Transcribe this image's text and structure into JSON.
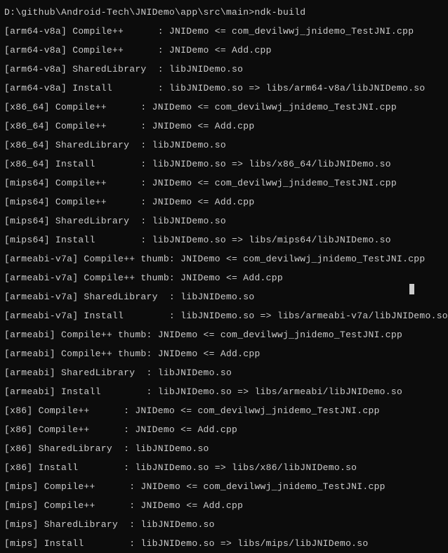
{
  "prompt": {
    "path": "D:\\github\\Android-Tech\\JNIDemo\\app\\src\\main>",
    "command": "ndk-build"
  },
  "lines": [
    "[arm64-v8a] Compile++      : JNIDemo <= com_devilwwj_jnidemo_TestJNI.cpp",
    "[arm64-v8a] Compile++      : JNIDemo <= Add.cpp",
    "[arm64-v8a] SharedLibrary  : libJNIDemo.so",
    "[arm64-v8a] Install        : libJNIDemo.so => libs/arm64-v8a/libJNIDemo.so",
    "[x86_64] Compile++      : JNIDemo <= com_devilwwj_jnidemo_TestJNI.cpp",
    "[x86_64] Compile++      : JNIDemo <= Add.cpp",
    "[x86_64] SharedLibrary  : libJNIDemo.so",
    "[x86_64] Install        : libJNIDemo.so => libs/x86_64/libJNIDemo.so",
    "[mips64] Compile++      : JNIDemo <= com_devilwwj_jnidemo_TestJNI.cpp",
    "[mips64] Compile++      : JNIDemo <= Add.cpp",
    "[mips64] SharedLibrary  : libJNIDemo.so",
    "[mips64] Install        : libJNIDemo.so => libs/mips64/libJNIDemo.so",
    "[armeabi-v7a] Compile++ thumb: JNIDemo <= com_devilwwj_jnidemo_TestJNI.cpp",
    "[armeabi-v7a] Compile++ thumb: JNIDemo <= Add.cpp",
    "[armeabi-v7a] SharedLibrary  : libJNIDemo.so",
    "[armeabi-v7a] Install        : libJNIDemo.so => libs/armeabi-v7a/libJNIDemo.so",
    "[armeabi] Compile++ thumb: JNIDemo <= com_devilwwj_jnidemo_TestJNI.cpp",
    "[armeabi] Compile++ thumb: JNIDemo <= Add.cpp",
    "[armeabi] SharedLibrary  : libJNIDemo.so",
    "[armeabi] Install        : libJNIDemo.so => libs/armeabi/libJNIDemo.so",
    "[x86] Compile++      : JNIDemo <= com_devilwwj_jnidemo_TestJNI.cpp",
    "[x86] Compile++      : JNIDemo <= Add.cpp",
    "[x86] SharedLibrary  : libJNIDemo.so",
    "[x86] Install        : libJNIDemo.so => libs/x86/libJNIDemo.so",
    "[mips] Compile++      : JNIDemo <= com_devilwwj_jnidemo_TestJNI.cpp",
    "[mips] Compile++      : JNIDemo <= Add.cpp",
    "[mips] SharedLibrary  : libJNIDemo.so",
    "[mips] Install        : libJNIDemo.so => libs/mips/libJNIDemo.so"
  ]
}
